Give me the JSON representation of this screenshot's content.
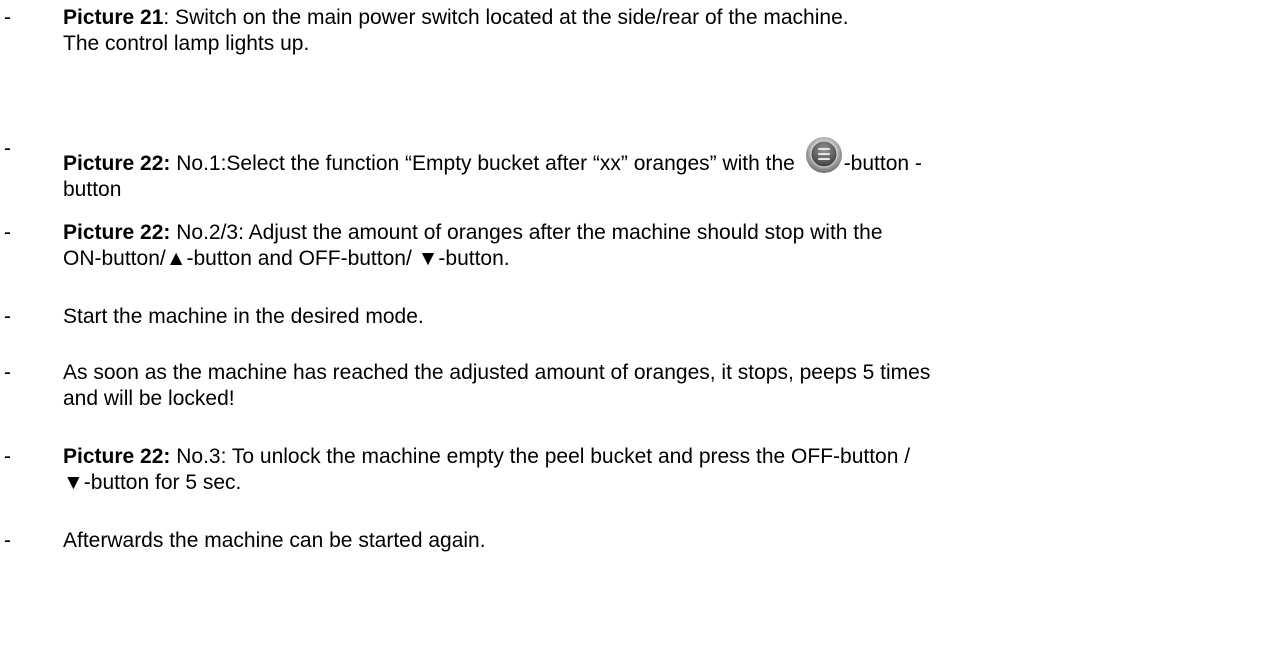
{
  "dash": "-",
  "items": [
    {
      "label": "Picture 21",
      "text": ": Switch on the main power switch located at the side/rear of the machine.",
      "line2": "The control lamp lights up."
    },
    {
      "label": "Picture 22:",
      "text_before_icon": " No.1:Select the function “Empty bucket after “xx” oranges” with the ",
      "text_after_icon": "-button -",
      "line2": "button"
    },
    {
      "label": "Picture 22:",
      "text": " No.2/3: Adjust the amount of oranges after the machine should stop with the",
      "line2": "ON-button/▲-button and OFF-button/ ▼-button."
    },
    {
      "text": "Start the machine in the desired mode."
    },
    {
      "text": "As soon as the machine has reached the adjusted amount of oranges, it stops, peeps 5 times",
      "line2": "and will be locked!"
    },
    {
      "label": "Picture 22:",
      "text": " No.3: To unlock the machine empty the peel bucket and press the OFF-button /",
      "line2": "▼-button for 5 sec."
    },
    {
      "text": "Afterwards the machine can be started again."
    }
  ],
  "icons": {
    "menu_button": "menu-button-icon"
  }
}
